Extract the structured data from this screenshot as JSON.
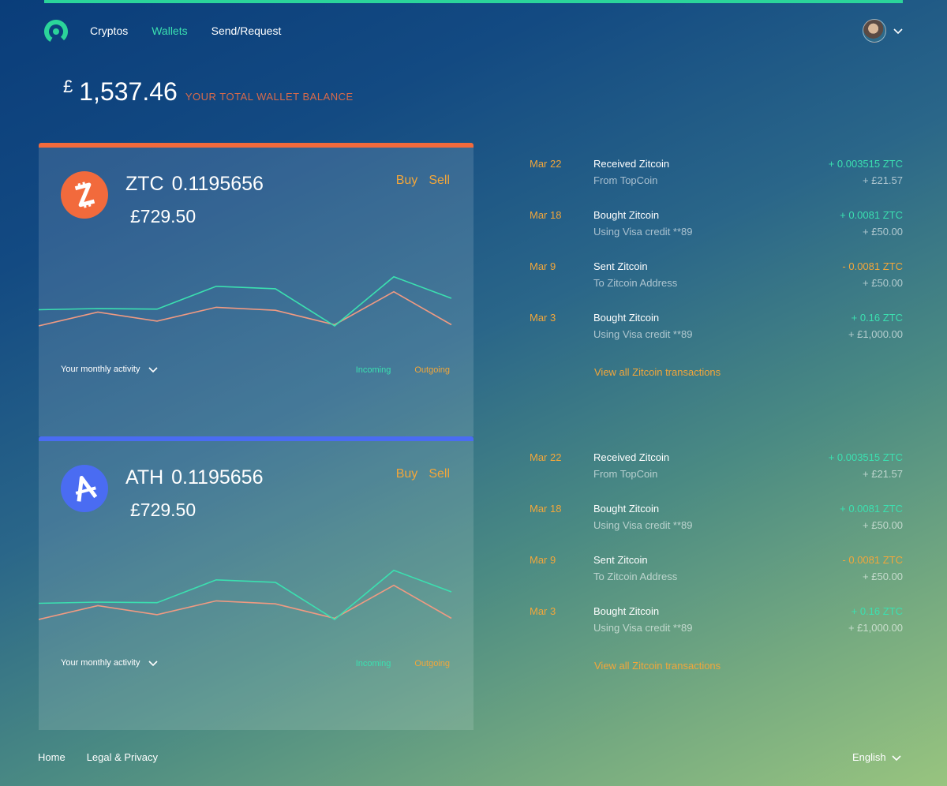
{
  "nav": {
    "items": [
      {
        "label": "Cryptos",
        "active": false
      },
      {
        "label": "Wallets",
        "active": true
      },
      {
        "label": "Send/Request",
        "active": false
      }
    ]
  },
  "balance": {
    "currency": "£",
    "amount": "1,537.46",
    "label": "YOUR TOTAL WALLET BALANCE"
  },
  "wallets": [
    {
      "ticker": "ZTC",
      "crypto_amount": "0.1195656",
      "fiat_amount": "£729.50",
      "buy_label": "Buy",
      "sell_label": "Sell",
      "activity_label": "Your monthly activity",
      "incoming_label": "Incoming",
      "outgoing_label": "Outgoing",
      "accent": "#f26a3c",
      "icon": "zitcoin-icon",
      "incoming": [
        0.27,
        0.29,
        0.28,
        0.66,
        0.62,
        0.0,
        0.82,
        0.46
      ],
      "outgoing": [
        0.0,
        0.23,
        0.08,
        0.31,
        0.26,
        0.02,
        0.57,
        0.02
      ]
    },
    {
      "ticker": "ATH",
      "crypto_amount": "0.1195656",
      "fiat_amount": "£729.50",
      "buy_label": "Buy",
      "sell_label": "Sell",
      "activity_label": "Your monthly activity",
      "incoming_label": "Incoming",
      "outgoing_label": "Outgoing",
      "accent": "#4a6cf2",
      "icon": "athcoin-icon",
      "incoming": [
        0.27,
        0.29,
        0.28,
        0.66,
        0.62,
        0.0,
        0.82,
        0.46
      ],
      "outgoing": [
        0.0,
        0.23,
        0.08,
        0.31,
        0.26,
        0.02,
        0.57,
        0.02
      ]
    }
  ],
  "transactions": [
    {
      "rows": [
        {
          "date": "Mar 22",
          "title": "Received Zitcoin",
          "sub": "From TopCoin",
          "crypto": "+ 0.003515 ZTC",
          "gbp": "+ £21.57",
          "negative": false
        },
        {
          "date": "Mar 18",
          "title": "Bought Zitcoin",
          "sub": "Using Visa credit **89",
          "crypto": "+ 0.0081 ZTC",
          "gbp": "+ £50.00",
          "negative": false
        },
        {
          "date": "Mar 9",
          "title": "Sent Zitcoin",
          "sub": "To Zitcoin Address",
          "crypto": "- 0.0081 ZTC",
          "gbp": "+ £50.00",
          "negative": true
        },
        {
          "date": "Mar 3",
          "title": "Bought Zitcoin",
          "sub": "Using Visa credit **89",
          "crypto": "+ 0.16 ZTC",
          "gbp": "+ £1,000.00",
          "negative": false
        }
      ],
      "view_all": "View all Zitcoin transactions"
    },
    {
      "rows": [
        {
          "date": "Mar 22",
          "title": "Received Zitcoin",
          "sub": "From TopCoin",
          "crypto": "+ 0.003515 ZTC",
          "gbp": "+ £21.57",
          "negative": false
        },
        {
          "date": "Mar 18",
          "title": "Bought Zitcoin",
          "sub": "Using Visa credit **89",
          "crypto": "+ 0.0081 ZTC",
          "gbp": "+ £50.00",
          "negative": false
        },
        {
          "date": "Mar 9",
          "title": "Sent Zitcoin",
          "sub": "To Zitcoin Address",
          "crypto": "- 0.0081 ZTC",
          "gbp": "+ £50.00",
          "negative": true
        },
        {
          "date": "Mar 3",
          "title": "Bought Zitcoin",
          "sub": "Using Visa credit **89",
          "crypto": "+ 0.16 ZTC",
          "gbp": "+ £1,000.00",
          "negative": false
        }
      ],
      "view_all": "View all Zitcoin transactions"
    }
  ],
  "footer": {
    "links": [
      "Home",
      "Legal & Privacy"
    ],
    "language": "English"
  },
  "colors": {
    "accent_green": "#3be0b0",
    "accent_orange": "#f2a63a",
    "balance_label": "#d86a4a",
    "top_bar": "#2bd49a"
  }
}
